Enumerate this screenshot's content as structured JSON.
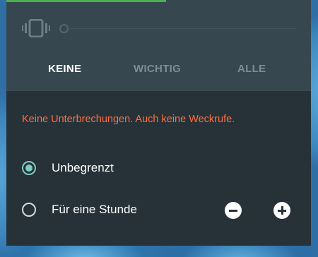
{
  "colors": {
    "panel_bg": "#263238",
    "header_bg": "#37474f",
    "accent": "#4caf50",
    "warning": "#ff6e40",
    "radio_selected": "#80cbc4"
  },
  "header": {
    "icon": "vibrate-icon",
    "tabs": [
      {
        "label": "KEINE",
        "selected": true
      },
      {
        "label": "WICHTIG",
        "selected": false
      },
      {
        "label": "ALLE",
        "selected": false
      }
    ]
  },
  "main": {
    "warning_text": "Keine Unterbrechungen. Auch keine Weckrufe.",
    "options": [
      {
        "label": "Unbegrenzt",
        "selected": true
      },
      {
        "label": "Für eine Stunde",
        "selected": false
      }
    ],
    "minus_icon": "minus-circle-icon",
    "plus_icon": "plus-circle-icon"
  }
}
